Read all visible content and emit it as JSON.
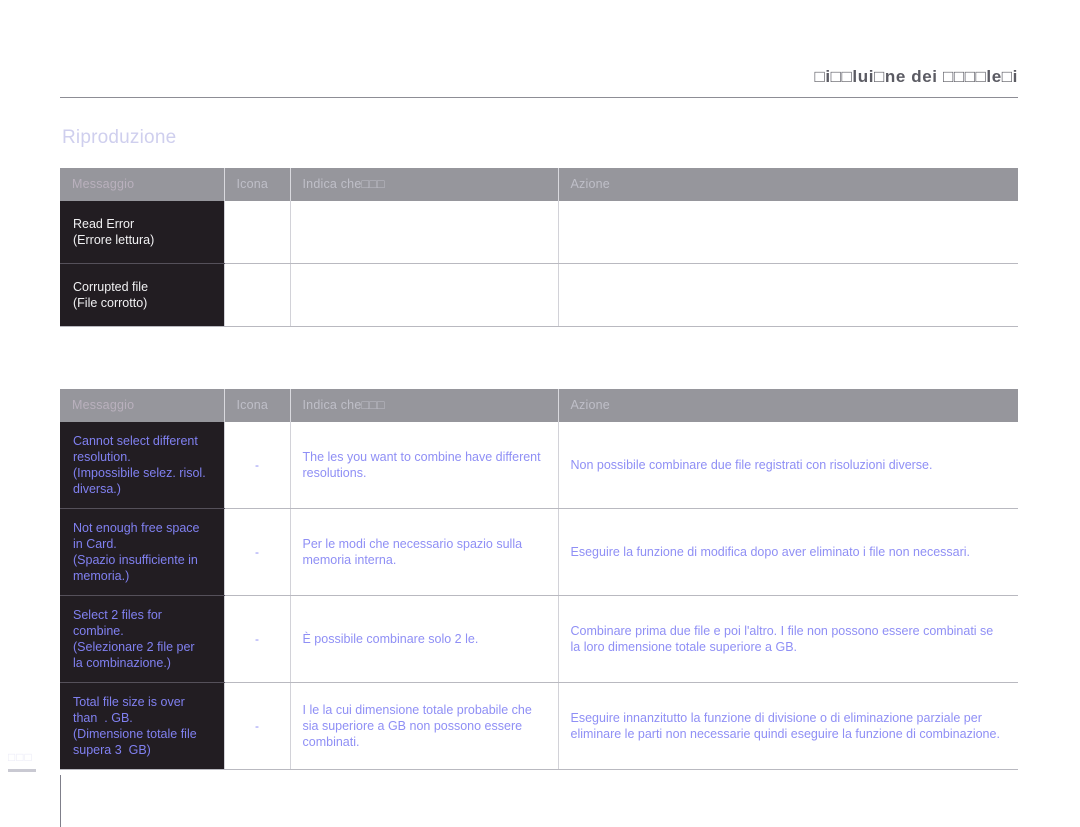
{
  "header": {
    "running_title": "□i□□lui□ne dei □□□□le□i"
  },
  "section": {
    "title": "Riproduzione"
  },
  "page_number": "□□□",
  "colors": {
    "header_text": "#5b5b63",
    "section_title": "#cfcfee",
    "table_header_bg": "#96969c",
    "table_header_text": "#bfbfc8",
    "message_cell_bg": "#221d22",
    "message_text_white": "#f0f0f2",
    "message_text_blue": "#8080f0",
    "body_text_blue": "#8f8ff5",
    "grid_line": "#b9b9c0"
  },
  "table_one": {
    "columns": [
      "Messaggio",
      "Icona",
      "Indica che□□□",
      "Azione"
    ],
    "rows": [
      {
        "message_en": "Read Error",
        "message_it": "(Errore lettura)",
        "icon": "",
        "means": "",
        "action": ""
      },
      {
        "message_en": "Corrupted file",
        "message_it": "(File corrotto)",
        "icon": "",
        "means": "",
        "action": ""
      }
    ]
  },
  "table_two": {
    "columns": [
      "Messaggio",
      "Icona",
      "Indica che□□□",
      "Azione"
    ],
    "rows": [
      {
        "message_en": "Cannot select different\nresolution.",
        "message_it": "(Impossibile selez. risol.\ndiversa.)",
        "icon": "-",
        "means": "The  les you want to combine have\ndifferent resolutions.",
        "action": "Non  possibile combinare due file registrati con risoluzioni diverse."
      },
      {
        "message_en": "Not enough free space\nin Card.",
        "message_it": "(Spazio insufficiente in\nmemoria.)",
        "icon": "-",
        "means": "Per le modi che  necessario spazio\nsulla memoria interna.",
        "action": "Eseguire la funzione di modifica dopo aver eliminato i file non necessari."
      },
      {
        "message_en": "Select 2 files for\ncombine.",
        "message_it": "(Selezionare 2 file per\nla combinazione.)",
        "icon": "-",
        "means": "È possibile combinare solo 2  le.",
        "action": "Combinare prima due file e poi l'altro. I file non possono essere\ncombinati se la loro dimensione totale  superiore a   GB."
      },
      {
        "message_en": "Total file size is over\nthan  . GB.",
        "message_it": "(Dimensione totale file\nsupera 3  GB)",
        "icon": "-",
        "means": "I  le la cui dimensione totale  probabile\nche sia superiore a    GB non possono\nessere combinati.",
        "action": "Eseguire innanzitutto la funzione di divisione o di eliminazione parziale\nper eliminare le parti non necessarie  quindi eseguire la funzione di\ncombinazione."
      }
    ]
  }
}
